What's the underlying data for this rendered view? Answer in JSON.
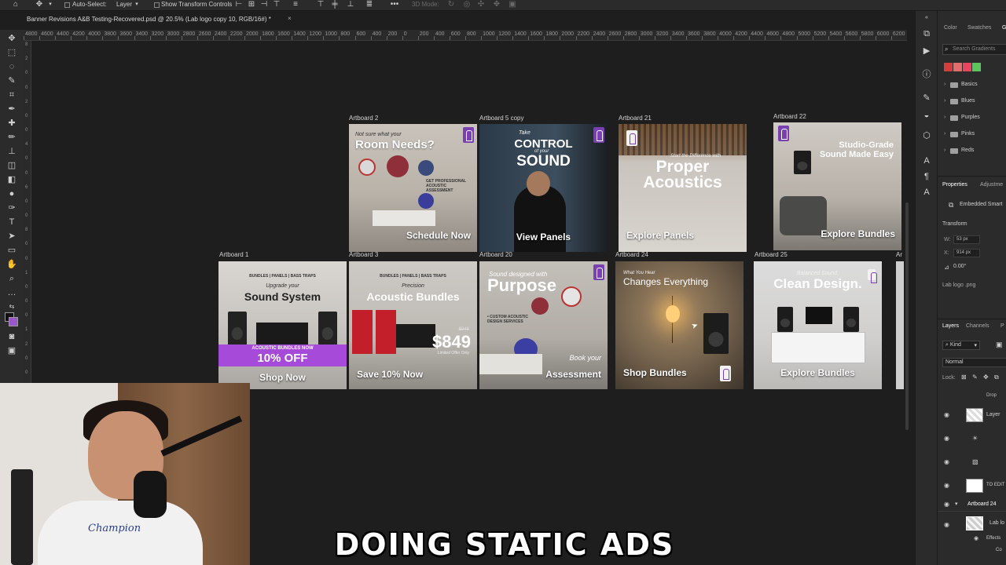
{
  "optbar": {
    "auto_select_label": "Auto-Select:",
    "layer_select": "Layer",
    "transform_label": "Show Transform Controls",
    "mode_3d": "3D Mode:"
  },
  "document": {
    "tab_title": "Banner Revisions A&B Testing-Recovered.psd @ 20.5% (Lab logo  copy 10, RGB/16#) *",
    "close": "×"
  },
  "ruler": {
    "h_ticks": [
      "4800",
      "4600",
      "4400",
      "4200",
      "4000",
      "3800",
      "3600",
      "3400",
      "3200",
      "3000",
      "2800",
      "2600",
      "2400",
      "2200",
      "2000",
      "1800",
      "1600",
      "1400",
      "1200",
      "1000",
      "800",
      "600",
      "400",
      "200",
      "0",
      "200",
      "400",
      "600",
      "800",
      "1000",
      "1200",
      "1400",
      "1600",
      "1800",
      "2000",
      "2200",
      "2400",
      "2600",
      "2800",
      "3000",
      "3200",
      "3400",
      "3600",
      "3800",
      "4000",
      "4200",
      "4400",
      "4600",
      "4800",
      "5000",
      "5200",
      "5400",
      "5600",
      "5800",
      "6000",
      "6200"
    ],
    "v_ticks": [
      "8",
      "2",
      "0",
      "0",
      "2",
      "0",
      "0",
      "4",
      "0",
      "0",
      "6",
      "0",
      "0",
      "8",
      "0",
      "0",
      "1",
      "0",
      "0",
      "0",
      "1",
      "2",
      "0",
      "0"
    ]
  },
  "artboards": {
    "ab2": {
      "label": "Artboard 2",
      "small": "Not sure what your",
      "head": "Room Needs?",
      "sub": "GET PROFESSIONAL ACOUSTIC ASSESSMENT",
      "cta": "Schedule Now"
    },
    "ab5c": {
      "label": "Artboard 5 copy",
      "small": "Take",
      "head1": "CONTROL",
      "small2": "of your",
      "head2": "SOUND",
      "cta": "View Panels"
    },
    "ab21": {
      "label": "Artboard 21",
      "small": "Start the Difference with",
      "head1": "Proper",
      "head2": "Acoustics",
      "cta": "Explore Panels"
    },
    "ab22": {
      "label": "Artboard 22",
      "head1": "Studio-Grade",
      "head2": "Sound Made Easy",
      "cta": "Explore Bundles"
    },
    "ab1": {
      "label": "Artboard 1",
      "top": "BUNDLES | PANELS | BASS TRAPS",
      "small": "Upgrade your",
      "head": "Sound System",
      "band_small": "ACOUSTIC BUNDLES NOW",
      "band": "10% OFF",
      "cta": "Shop Now"
    },
    "ab3": {
      "label": "Artboard 3",
      "top": "BUNDLES | PANELS | BASS TRAPS",
      "small": "Precision",
      "head": "Acoustic Bundles",
      "old_price": "$949",
      "price": "$849",
      "limited": "Limited Offer Only",
      "cta": "Save 10% Now"
    },
    "ab20": {
      "label": "Artboard 20",
      "small": "Sound designed with",
      "head": "Purpose",
      "bullets": "• CUSTOM ACOUSTIC DESIGN SERVICES",
      "cta_small": "Book your",
      "cta": "Assessment"
    },
    "ab24": {
      "label": "Artboard 24",
      "small": "What You Hear",
      "head": "Changes Everything",
      "cta": "Shop Bundles"
    },
    "ab25": {
      "label": "Artboard 25",
      "small": "Balanced Sound,",
      "head": "Clean Design.",
      "cta": "Explore Bundles"
    },
    "ab_cut": {
      "label": "Ar"
    }
  },
  "right_panel": {
    "tabs": [
      "Color",
      "Swatches",
      "Gr"
    ],
    "search_placeholder": "Search Gradients",
    "gradient_swatches": [
      "#d33d3d",
      "#e36d6d",
      "#e8465f",
      "#5ec45e",
      "#3fa64c"
    ],
    "folders": [
      "Basics",
      "Blues",
      "Purples",
      "Pinks",
      "Reds"
    ],
    "properties_tab": "Properties",
    "adjustments_tab": "Adjustme",
    "embedded": "Embedded Smart",
    "transform": "Transform",
    "w_label": "W:",
    "w_value": "53 px",
    "x_label": "X:",
    "x_value": "914 px",
    "angle": "0.00°",
    "filename": "Lab logo .png",
    "layers_tab": "Layers",
    "channels_tab": "Channels",
    "p_tab": "P",
    "kind": "Kind",
    "blend": "Normal",
    "lock": "Lock:",
    "rows": [
      "Drop",
      "Layer",
      "",
      "",
      "TO EDIT",
      "Artboard 24",
      "Lab lo",
      "Effects",
      "Co"
    ]
  },
  "caption": "DOING STATIC ADS"
}
